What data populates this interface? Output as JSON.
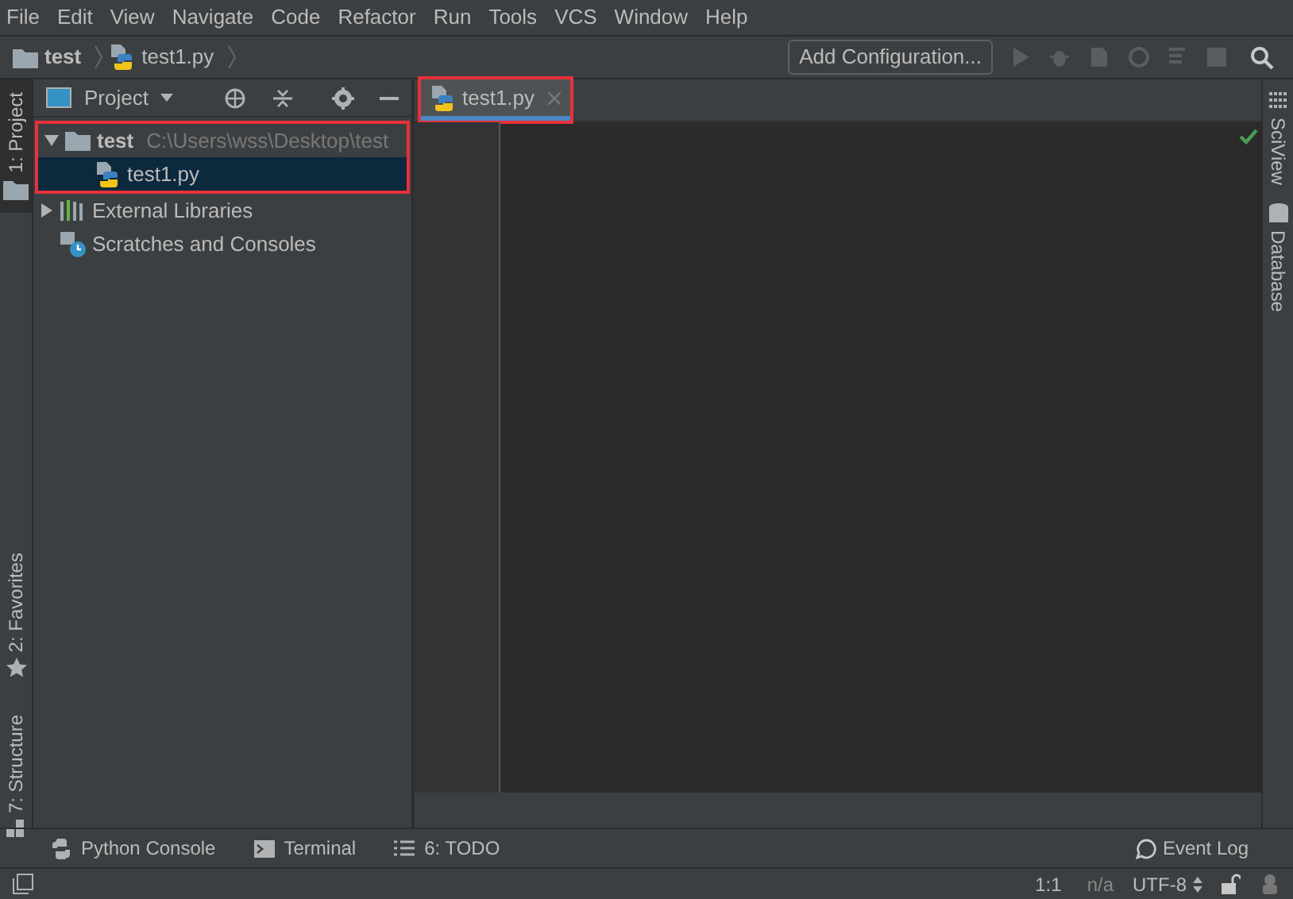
{
  "menu": [
    "File",
    "Edit",
    "View",
    "Navigate",
    "Code",
    "Refactor",
    "Run",
    "Tools",
    "VCS",
    "Window",
    "Help"
  ],
  "breadcrumbs": [
    {
      "label": "test",
      "kind": "folder"
    },
    {
      "label": "test1.py",
      "kind": "python"
    }
  ],
  "toolbar": {
    "run_config": "Add Configuration..."
  },
  "left_strip": [
    {
      "label": "1: Project",
      "selected": true,
      "kind": "folder"
    },
    {
      "label": "2: Favorites",
      "selected": false,
      "kind": "star"
    },
    {
      "label": "7: Structure",
      "selected": false,
      "kind": "structure"
    }
  ],
  "right_strip": [
    {
      "label": "SciView",
      "kind": "grid"
    },
    {
      "label": "Database",
      "kind": "database"
    }
  ],
  "project_panel": {
    "title": "Project",
    "tree": [
      {
        "label": "test",
        "path": "C:\\Users\\wss\\Desktop\\test",
        "kind": "folder",
        "expanded": true,
        "selected": false,
        "highlighted": true,
        "children": [
          {
            "label": "test1.py",
            "kind": "python",
            "selected": true,
            "highlighted": true
          }
        ]
      },
      {
        "label": "External Libraries",
        "kind": "library",
        "expanded": false,
        "selected": false,
        "highlighted": false
      },
      {
        "label": "Scratches and Consoles",
        "kind": "scratch",
        "selected": false,
        "highlighted": false
      }
    ]
  },
  "editor_tabs": [
    {
      "label": "test1.py",
      "selected": true,
      "highlighted": true
    }
  ],
  "bottom_tools": [
    {
      "label": "Python Console",
      "kind": "python"
    },
    {
      "label": "Terminal",
      "kind": "terminal"
    },
    {
      "label": "6: TODO",
      "kind": "list"
    }
  ],
  "event_log": "Event Log",
  "status_bar": {
    "position": "1:1",
    "line_sep": "n/a",
    "encoding": "UTF-8"
  }
}
